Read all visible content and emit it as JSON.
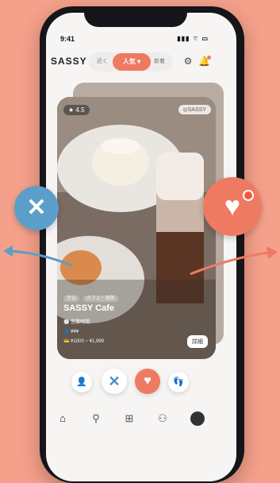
{
  "status": {
    "time": "9:41",
    "signal": "▮▮▮",
    "wifi": "⌔",
    "battery": "▭"
  },
  "header": {
    "logo": "SASSY",
    "segments": {
      "left": "近く",
      "active": "人気",
      "right": "新着"
    },
    "settings_icon": "gear-icon",
    "notification_icon": "bell-icon"
  },
  "card": {
    "rating": "4.5",
    "badge": "SASSY",
    "tags": [
      "渋谷",
      "カフェ・喫茶"
    ],
    "name": "SASSY Cafe",
    "hours": "営業時間",
    "price_level": "¥¥¥",
    "price_range": "¥1000 ~ ¥1,999",
    "detail_label": "詳細"
  },
  "actions": {
    "profile": "👤",
    "nope": "✕",
    "like": "♥",
    "super": "👣"
  },
  "colors": {
    "accent": "#ef7a62",
    "nope_blue": "#5b9ec9",
    "background": "#f4a08a"
  },
  "tabbar": {
    "home": "⌂",
    "search": "⚲",
    "post": "⊞",
    "people": "⚇"
  },
  "floats": {
    "nope": "✕",
    "like": "♥"
  }
}
